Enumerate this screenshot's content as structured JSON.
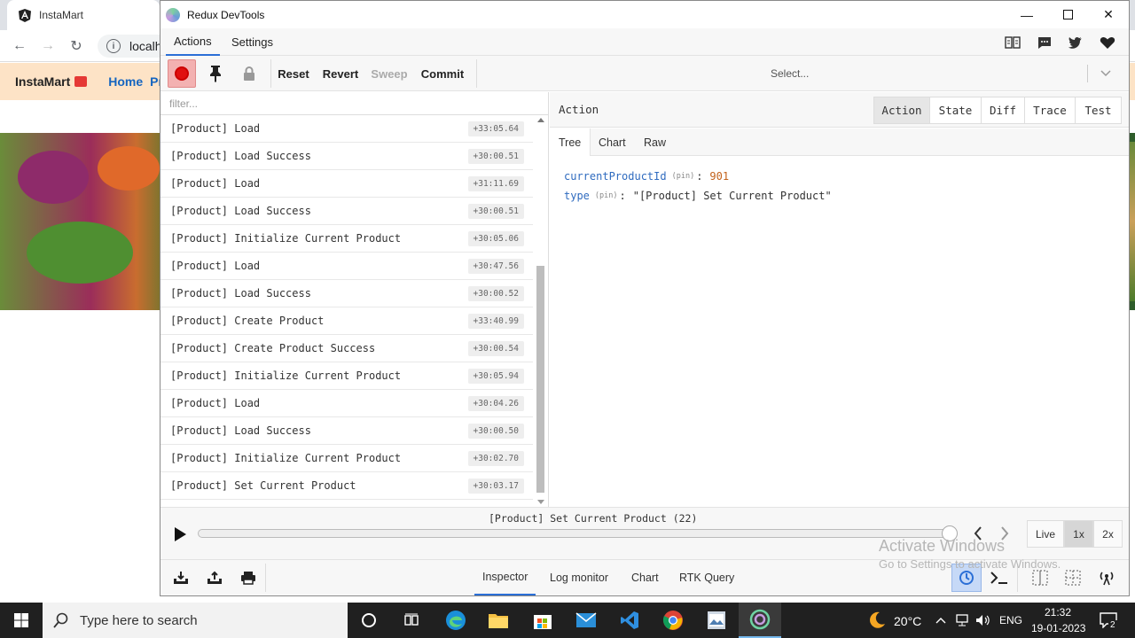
{
  "browser": {
    "tab_title": "InstaMart",
    "address": "localh",
    "brand": "InstaMart",
    "nav_home": "Home",
    "nav_products": "Pro"
  },
  "devtools": {
    "window_title": "Redux DevTools",
    "menu": {
      "actions": "Actions",
      "settings": "Settings"
    },
    "toolbar": {
      "reset": "Reset",
      "revert": "Revert",
      "sweep": "Sweep",
      "commit": "Commit",
      "select_placeholder": "Select..."
    },
    "filter_placeholder": "filter...",
    "actions": [
      {
        "name": "[Product] Load",
        "time": "+33:05.64"
      },
      {
        "name": "[Product] Load Success",
        "time": "+30:00.51"
      },
      {
        "name": "[Product] Load",
        "time": "+31:11.69"
      },
      {
        "name": "[Product] Load Success",
        "time": "+30:00.51"
      },
      {
        "name": "[Product] Initialize Current Product",
        "time": "+30:05.06"
      },
      {
        "name": "[Product] Load",
        "time": "+30:47.56"
      },
      {
        "name": "[Product] Load Success",
        "time": "+30:00.52"
      },
      {
        "name": "[Product] Create Product",
        "time": "+33:40.99"
      },
      {
        "name": "[Product] Create Product Success",
        "time": "+30:00.54"
      },
      {
        "name": "[Product] Initialize Current Product",
        "time": "+30:05.94"
      },
      {
        "name": "[Product] Load",
        "time": "+30:04.26"
      },
      {
        "name": "[Product] Load Success",
        "time": "+30:00.50"
      },
      {
        "name": "[Product] Initialize Current Product",
        "time": "+30:02.70"
      },
      {
        "name": "[Product] Set Current Product",
        "time": "+30:03.17"
      }
    ],
    "inspector": {
      "title": "Action",
      "tabs": [
        "Action",
        "State",
        "Diff",
        "Trace",
        "Test"
      ],
      "active_tab": "Action",
      "subtabs": [
        "Tree",
        "Chart",
        "Raw"
      ],
      "active_subtab": "Tree",
      "tree": {
        "row1_key": "currentProductId",
        "row1_pin": "(pin)",
        "row1_value": "901",
        "row2_key": "type",
        "row2_pin": "(pin)",
        "row2_value": "\"[Product] Set Current Product\""
      }
    },
    "slider": {
      "label": "[Product] Set Current Product (22)",
      "position": 1.0,
      "live": "Live",
      "speed_1x": "1x",
      "speed_2x": "2x",
      "active_speed": "1x"
    },
    "monitors": [
      "Inspector",
      "Log monitor",
      "Chart",
      "RTK Query"
    ],
    "active_monitor": "Inspector",
    "activate_windows": {
      "line1": "Activate Windows",
      "line2": "Go to Settings to activate Windows."
    }
  },
  "taskbar": {
    "search_placeholder": "Type here to search",
    "weather": "20°C",
    "lang": "ENG",
    "time": "21:32",
    "date": "19-01-2023",
    "notifications": "2"
  },
  "colors": {
    "accent": "#2b6fd6",
    "record": "#e01010",
    "tree_key": "#2f6bbf",
    "tree_number": "#c2611a"
  }
}
